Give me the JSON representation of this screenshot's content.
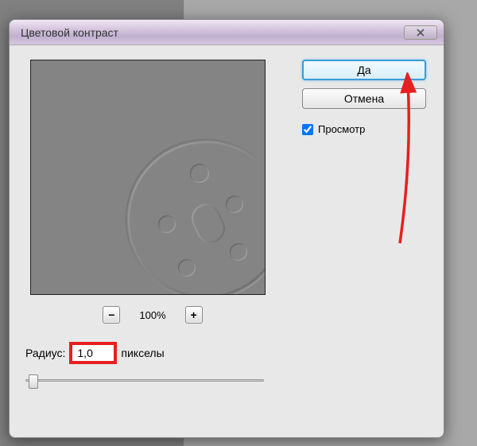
{
  "dialog": {
    "title": "Цветовой контраст"
  },
  "zoom": {
    "minus_label": "−",
    "plus_label": "+",
    "level": "100%"
  },
  "radius": {
    "label": "Радиус:",
    "value": "1,0",
    "units": "пикселы"
  },
  "buttons": {
    "ok": "Да",
    "cancel": "Отмена"
  },
  "preview_checkbox": {
    "label": "Просмотр",
    "checked": true
  },
  "colors": {
    "highlight_red": "#e62020",
    "arrow_red": "#e62020",
    "primary_border": "#3a9cd8"
  }
}
